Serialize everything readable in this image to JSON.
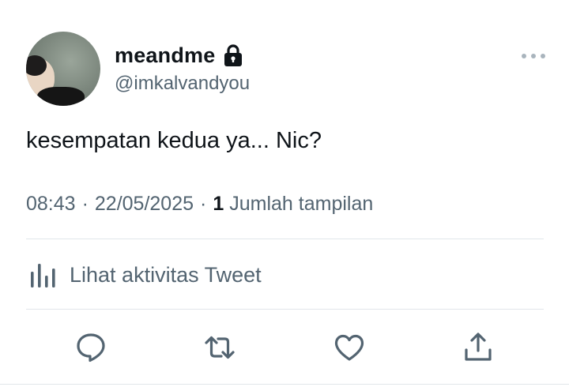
{
  "user": {
    "display_name": "meandme",
    "handle": "@imkalvandyou",
    "protected": true
  },
  "tweet": {
    "text": "kesempatan kedua ya... Nic?",
    "time": "08:43",
    "date": "22/05/2025",
    "separator": "·",
    "views_count": "1",
    "views_label": "Jumlah tampilan"
  },
  "activity": {
    "label": "Lihat aktivitas Tweet"
  },
  "actions": [
    {
      "name": "reply",
      "icon": "reply-icon"
    },
    {
      "name": "retweet",
      "icon": "retweet-icon"
    },
    {
      "name": "like",
      "icon": "heart-icon"
    },
    {
      "name": "share",
      "icon": "share-icon"
    }
  ],
  "colors": {
    "primary_text": "#0f1419",
    "secondary_text": "#536471",
    "divider": "#e1e6ea",
    "more_dots": "#a9b4bd"
  }
}
